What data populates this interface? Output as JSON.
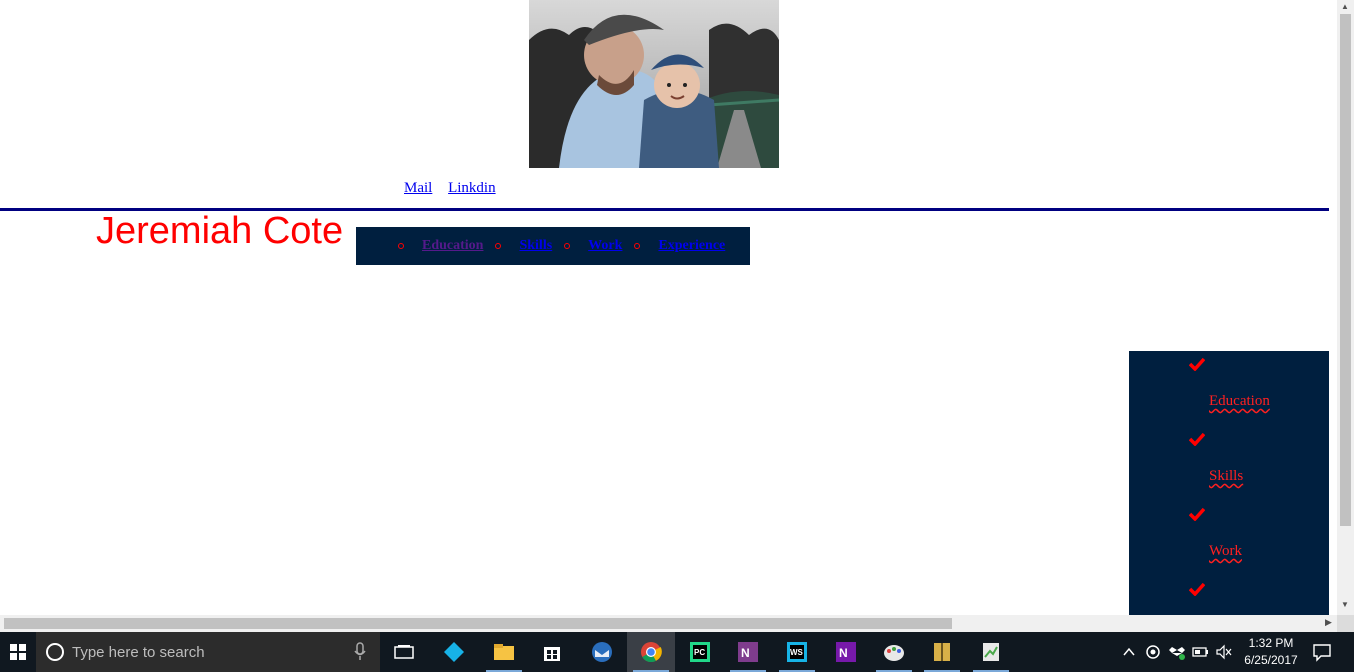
{
  "page": {
    "links": {
      "mail": "Mail",
      "linkedin": "Linkdin"
    },
    "name": "Jeremiah Cote",
    "nav": [
      "Education",
      "Skills",
      "Work",
      "Experience"
    ],
    "side_nav": [
      "Education",
      "Skills",
      "Work"
    ],
    "colors": {
      "accent_red": "#ff0000",
      "navy": "#001f3f",
      "rule": "#000080",
      "link": "#0000ee"
    }
  },
  "taskbar": {
    "search_placeholder": "Type here to search",
    "apps": [
      "task-view",
      "kodi",
      "file-explorer",
      "store",
      "thunderbird",
      "chrome",
      "pycharm",
      "onenote",
      "webstorm",
      "onenote-2016",
      "paint",
      "archive",
      "notepad-plus"
    ],
    "clock": {
      "time": "1:32 PM",
      "date": "6/25/2017"
    }
  }
}
